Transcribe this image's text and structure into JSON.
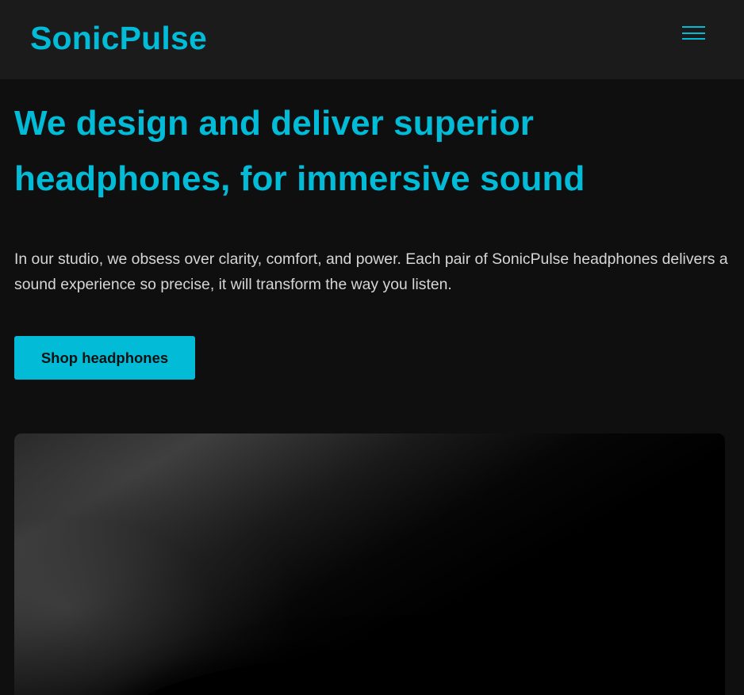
{
  "header": {
    "brand": "SonicPulse",
    "menu_icon": "hamburger-menu-icon"
  },
  "hero": {
    "title": "We design and deliver superior headphones, for immersive sound",
    "description": "In our studio, we obsess over clarity, comfort, and power. Each pair of SonicPulse headphones delivers a sound experience so precise, it will transform the way you listen.",
    "cta_label": "Shop headphones"
  },
  "colors": {
    "accent": "#02bbd7",
    "page_background": "#0f0f0f",
    "header_background": "#1b1b1c",
    "body_text": "#d6d6d6"
  }
}
